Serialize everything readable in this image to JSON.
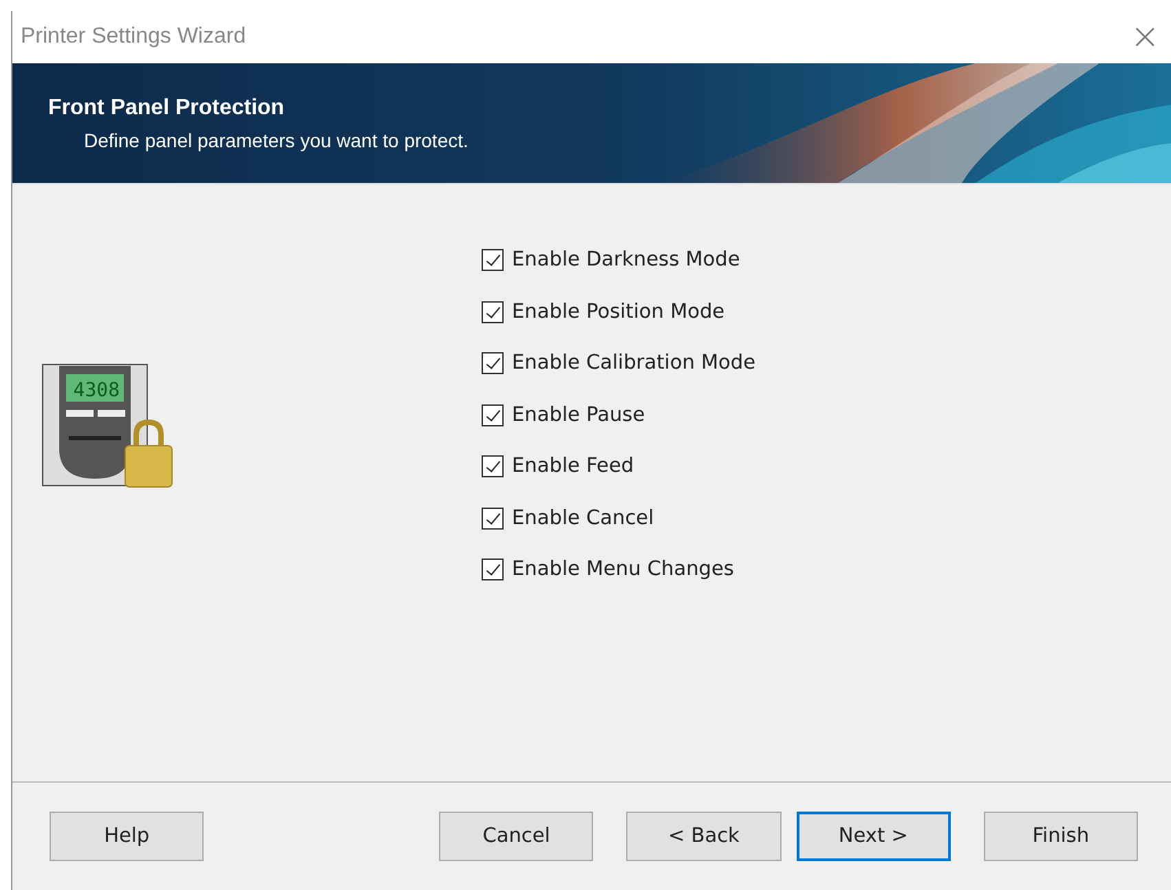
{
  "window": {
    "title": "Printer Settings Wizard",
    "close": "×"
  },
  "banner": {
    "title": "Front Panel Protection",
    "subtitle": "Define panel parameters you want to protect."
  },
  "panel_icon": {
    "display": "4308"
  },
  "options": [
    {
      "label": "Enable Darkness Mode",
      "checked": true
    },
    {
      "label": "Enable Position Mode",
      "checked": true
    },
    {
      "label": "Enable Calibration Mode",
      "checked": true
    },
    {
      "label": "Enable Pause",
      "checked": true
    },
    {
      "label": "Enable Feed",
      "checked": true
    },
    {
      "label": "Enable Cancel",
      "checked": true
    },
    {
      "label": "Enable Menu Changes",
      "checked": true
    }
  ],
  "buttons": [
    {
      "label": "Help",
      "focused": false
    },
    {
      "label": "Cancel",
      "focused": false
    },
    {
      "label": "< Back",
      "focused": false
    },
    {
      "label": "Next >",
      "focused": true
    },
    {
      "label": "Finish",
      "focused": false
    }
  ]
}
